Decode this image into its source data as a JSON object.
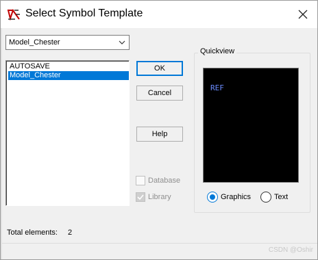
{
  "window": {
    "title": "Select Symbol Template",
    "close_icon": "close-icon",
    "app_icon": "symbol-template-icon"
  },
  "template_combo": {
    "selected": "Model_Chester",
    "arrow_icon": "chevron-down-icon"
  },
  "template_list": {
    "items": [
      "AUTOSAVE",
      "Model_Chester"
    ],
    "selected_index": 1
  },
  "buttons": {
    "ok": "OK",
    "cancel": "Cancel",
    "help": "Help"
  },
  "filters": {
    "database_label": "Database",
    "database_checked": false,
    "library_label": "Library",
    "library_checked": true
  },
  "quickview": {
    "label": "Quickview",
    "preview_text": "REF",
    "mode_graphics": "Graphics",
    "mode_text": "Text",
    "selected_mode": "Graphics"
  },
  "status": {
    "total_label": "Total elements:",
    "total_value": "2"
  },
  "watermark": "CSDN @Oshir",
  "colors": {
    "accent": "#0078d7",
    "preview_bg": "#000000",
    "preview_text": "#6b8cff"
  }
}
